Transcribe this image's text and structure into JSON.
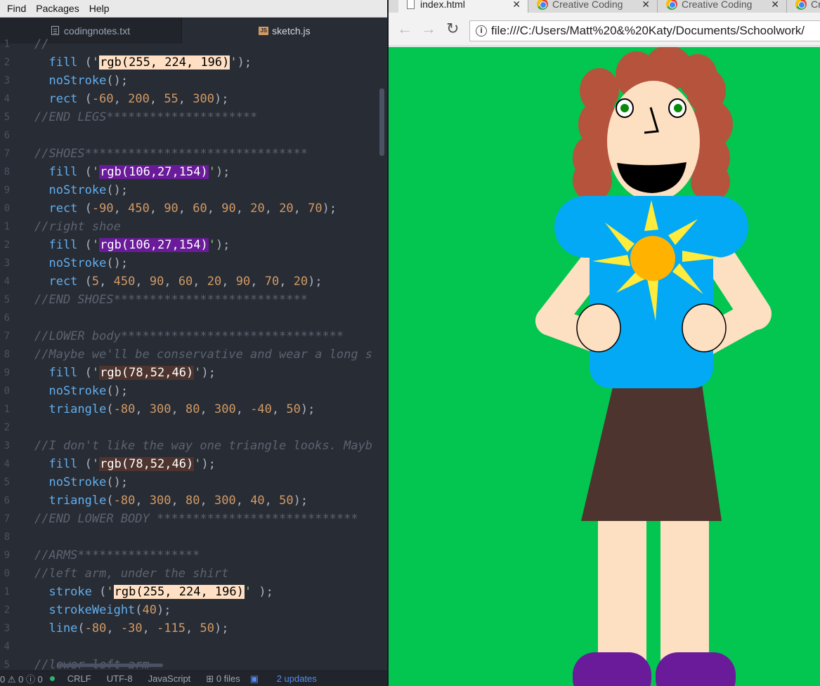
{
  "editor": {
    "menu": [
      "Find",
      "Packages",
      "Help"
    ],
    "tabs": [
      {
        "label": "codingnotes.txt",
        "icon": "text-file-icon"
      },
      {
        "label": "sketch.js",
        "icon": "js-file-icon"
      }
    ],
    "gutter": [
      "1",
      "2",
      "3",
      "4",
      "5",
      "6",
      "7",
      "8",
      "9",
      "0",
      "1",
      "2",
      "3",
      "4",
      "5",
      "6",
      "7",
      "8",
      "9",
      "0",
      "1",
      "2",
      "3",
      "4",
      "5",
      "6",
      "7",
      "8",
      "9",
      "0",
      "1",
      "2",
      "3",
      "4",
      "5"
    ],
    "code_lines": [
      [
        [
          "c",
          "//"
        ]
      ],
      [
        [
          "f",
          "  fill "
        ],
        [
          "p",
          "("
        ],
        [
          "s",
          "'"
        ],
        [
          "sw",
          "rgb(255, 224, 196)",
          "#ffe0c4"
        ],
        [
          "s",
          "'"
        ],
        [
          "p",
          ");"
        ]
      ],
      [
        [
          "f",
          "  noStroke"
        ],
        [
          "p",
          "();"
        ]
      ],
      [
        [
          "f",
          "  rect "
        ],
        [
          "p",
          "("
        ],
        [
          "n",
          "-60"
        ],
        [
          "p",
          ", "
        ],
        [
          "n",
          "200"
        ],
        [
          "p",
          ", "
        ],
        [
          "n",
          "55"
        ],
        [
          "p",
          ", "
        ],
        [
          "n",
          "300"
        ],
        [
          "p",
          ");"
        ]
      ],
      [
        [
          "c",
          "//END LEGS*********************"
        ]
      ],
      [
        [
          "p",
          ""
        ]
      ],
      [
        [
          "c",
          "//SHOES*******************************"
        ]
      ],
      [
        [
          "f",
          "  fill "
        ],
        [
          "p",
          "("
        ],
        [
          "s",
          "'"
        ],
        [
          "sw",
          "rgb(106,27,154)",
          "#6a1b9a"
        ],
        [
          "s",
          "'"
        ],
        [
          "p",
          ");"
        ]
      ],
      [
        [
          "f",
          "  noStroke"
        ],
        [
          "p",
          "();"
        ]
      ],
      [
        [
          "f",
          "  rect "
        ],
        [
          "p",
          "("
        ],
        [
          "n",
          "-90"
        ],
        [
          "p",
          ", "
        ],
        [
          "n",
          "450"
        ],
        [
          "p",
          ", "
        ],
        [
          "n",
          "90"
        ],
        [
          "p",
          ", "
        ],
        [
          "n",
          "60"
        ],
        [
          "p",
          ", "
        ],
        [
          "n",
          "90"
        ],
        [
          "p",
          ", "
        ],
        [
          "n",
          "20"
        ],
        [
          "p",
          ", "
        ],
        [
          "n",
          "20"
        ],
        [
          "p",
          ", "
        ],
        [
          "n",
          "70"
        ],
        [
          "p",
          ");"
        ]
      ],
      [
        [
          "c",
          "//right shoe"
        ]
      ],
      [
        [
          "f",
          "  fill "
        ],
        [
          "p",
          "("
        ],
        [
          "s",
          "'"
        ],
        [
          "sw",
          "rgb(106,27,154)",
          "#6a1b9a"
        ],
        [
          "s",
          "'"
        ],
        [
          "p",
          ");"
        ]
      ],
      [
        [
          "f",
          "  noStroke"
        ],
        [
          "p",
          "();"
        ]
      ],
      [
        [
          "f",
          "  rect "
        ],
        [
          "p",
          "("
        ],
        [
          "n",
          "5"
        ],
        [
          "p",
          ", "
        ],
        [
          "n",
          "450"
        ],
        [
          "p",
          ", "
        ],
        [
          "n",
          "90"
        ],
        [
          "p",
          ", "
        ],
        [
          "n",
          "60"
        ],
        [
          "p",
          ", "
        ],
        [
          "n",
          "20"
        ],
        [
          "p",
          ", "
        ],
        [
          "n",
          "90"
        ],
        [
          "p",
          ", "
        ],
        [
          "n",
          "70"
        ],
        [
          "p",
          ", "
        ],
        [
          "n",
          "20"
        ],
        [
          "p",
          ");"
        ]
      ],
      [
        [
          "c",
          "//END SHOES***************************"
        ]
      ],
      [
        [
          "p",
          ""
        ]
      ],
      [
        [
          "c",
          "//LOWER body*******************************"
        ]
      ],
      [
        [
          "c",
          "//Maybe we'll be conservative and wear a long s"
        ]
      ],
      [
        [
          "f",
          "  fill "
        ],
        [
          "p",
          "("
        ],
        [
          "s",
          "'"
        ],
        [
          "sw",
          "rgb(78,52,46)",
          "#4e342e"
        ],
        [
          "s",
          "'"
        ],
        [
          "p",
          ");"
        ]
      ],
      [
        [
          "f",
          "  noStroke"
        ],
        [
          "p",
          "();"
        ]
      ],
      [
        [
          "f",
          "  triangle"
        ],
        [
          "p",
          "("
        ],
        [
          "n",
          "-80"
        ],
        [
          "p",
          ", "
        ],
        [
          "n",
          "300"
        ],
        [
          "p",
          ", "
        ],
        [
          "n",
          "80"
        ],
        [
          "p",
          ", "
        ],
        [
          "n",
          "300"
        ],
        [
          "p",
          ", "
        ],
        [
          "n",
          "-40"
        ],
        [
          "p",
          ", "
        ],
        [
          "n",
          "50"
        ],
        [
          "p",
          ");"
        ]
      ],
      [
        [
          "p",
          ""
        ]
      ],
      [
        [
          "c",
          "//I don't like the way one triangle looks. Mayb"
        ]
      ],
      [
        [
          "f",
          "  fill "
        ],
        [
          "p",
          "("
        ],
        [
          "s",
          "'"
        ],
        [
          "sw",
          "rgb(78,52,46)",
          "#4e342e"
        ],
        [
          "s",
          "'"
        ],
        [
          "p",
          ");"
        ]
      ],
      [
        [
          "f",
          "  noStroke"
        ],
        [
          "p",
          "();"
        ]
      ],
      [
        [
          "f",
          "  triangle"
        ],
        [
          "p",
          "("
        ],
        [
          "n",
          "-80"
        ],
        [
          "p",
          ", "
        ],
        [
          "n",
          "300"
        ],
        [
          "p",
          ", "
        ],
        [
          "n",
          "80"
        ],
        [
          "p",
          ", "
        ],
        [
          "n",
          "300"
        ],
        [
          "p",
          ", "
        ],
        [
          "n",
          "40"
        ],
        [
          "p",
          ", "
        ],
        [
          "n",
          "50"
        ],
        [
          "p",
          ");"
        ]
      ],
      [
        [
          "c",
          "//END LOWER BODY ****************************"
        ]
      ],
      [
        [
          "p",
          ""
        ]
      ],
      [
        [
          "c",
          "//ARMS*****************"
        ]
      ],
      [
        [
          "c",
          "//left arm, under the shirt"
        ]
      ],
      [
        [
          "f",
          "  stroke "
        ],
        [
          "p",
          "("
        ],
        [
          "s",
          "'"
        ],
        [
          "sw",
          "rgb(255, 224, 196)",
          "#ffe0c4"
        ],
        [
          "s",
          "'"
        ],
        [
          "p",
          " );"
        ]
      ],
      [
        [
          "f",
          "  strokeWeight"
        ],
        [
          "p",
          "("
        ],
        [
          "n",
          "40"
        ],
        [
          "p",
          ");"
        ]
      ],
      [
        [
          "f",
          "  line"
        ],
        [
          "p",
          "("
        ],
        [
          "n",
          "-80"
        ],
        [
          "p",
          ", "
        ],
        [
          "n",
          "-30"
        ],
        [
          "p",
          ", "
        ],
        [
          "n",
          "-115"
        ],
        [
          "p",
          ", "
        ],
        [
          "n",
          "50"
        ],
        [
          "p",
          ");"
        ]
      ],
      [
        [
          "p",
          ""
        ]
      ],
      [
        [
          "c",
          "//lower left arm"
        ]
      ]
    ],
    "status": {
      "problems": "0 ⚠ 0 ⓘ 0",
      "line_ending": "CRLF",
      "encoding": "UTF-8",
      "grammar": "JavaScript",
      "git_files": "0 files",
      "updates": "2 updates"
    }
  },
  "browser": {
    "tabs": [
      {
        "label": "index.html",
        "icon": "page-icon"
      },
      {
        "label": "Creative Coding",
        "icon": "chrome-icon"
      },
      {
        "label": "Creative Coding",
        "icon": "chrome-icon"
      },
      {
        "label": "Cr",
        "icon": "chrome-icon"
      }
    ],
    "close_glyph": "✕",
    "url": "file:///C:/Users/Matt%20&%20Katy/Documents/Schoolwork/",
    "canvas_bg": "#02c650"
  },
  "colors": {
    "skin": "#fddfc2",
    "hair": "#b5533c",
    "shirt": "#03a9f4",
    "sun_core": "#ffb300",
    "sun_rays": "#ffeb3b",
    "skirt": "#4e342e",
    "shoes": "#6a1b9a",
    "eye_iris": "#0a8a0a"
  }
}
